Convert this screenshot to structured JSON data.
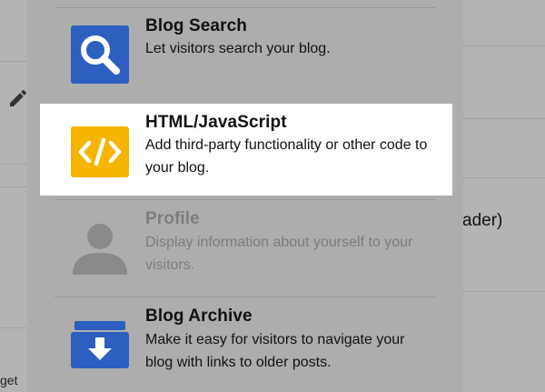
{
  "background": {
    "right_text": "ader)",
    "left_text": "get"
  },
  "widgets": [
    {
      "title": "Blog Search",
      "description": "Let visitors search your blog.",
      "icon": "search-icon",
      "color": "#2c5fbf"
    },
    {
      "title": "HTML/JavaScript",
      "description": "Add third-party functionality or other code to your blog.",
      "icon": "code-icon",
      "color": "#f6b500"
    },
    {
      "title": "Profile",
      "description": "Display information about yourself to your visitors.",
      "icon": "person-icon",
      "color": "#8a8a8a"
    },
    {
      "title": "Blog Archive",
      "description": "Make it easy for visitors to navigate your blog with links to older posts.",
      "icon": "archive-icon",
      "color": "#2c5fbf"
    }
  ]
}
